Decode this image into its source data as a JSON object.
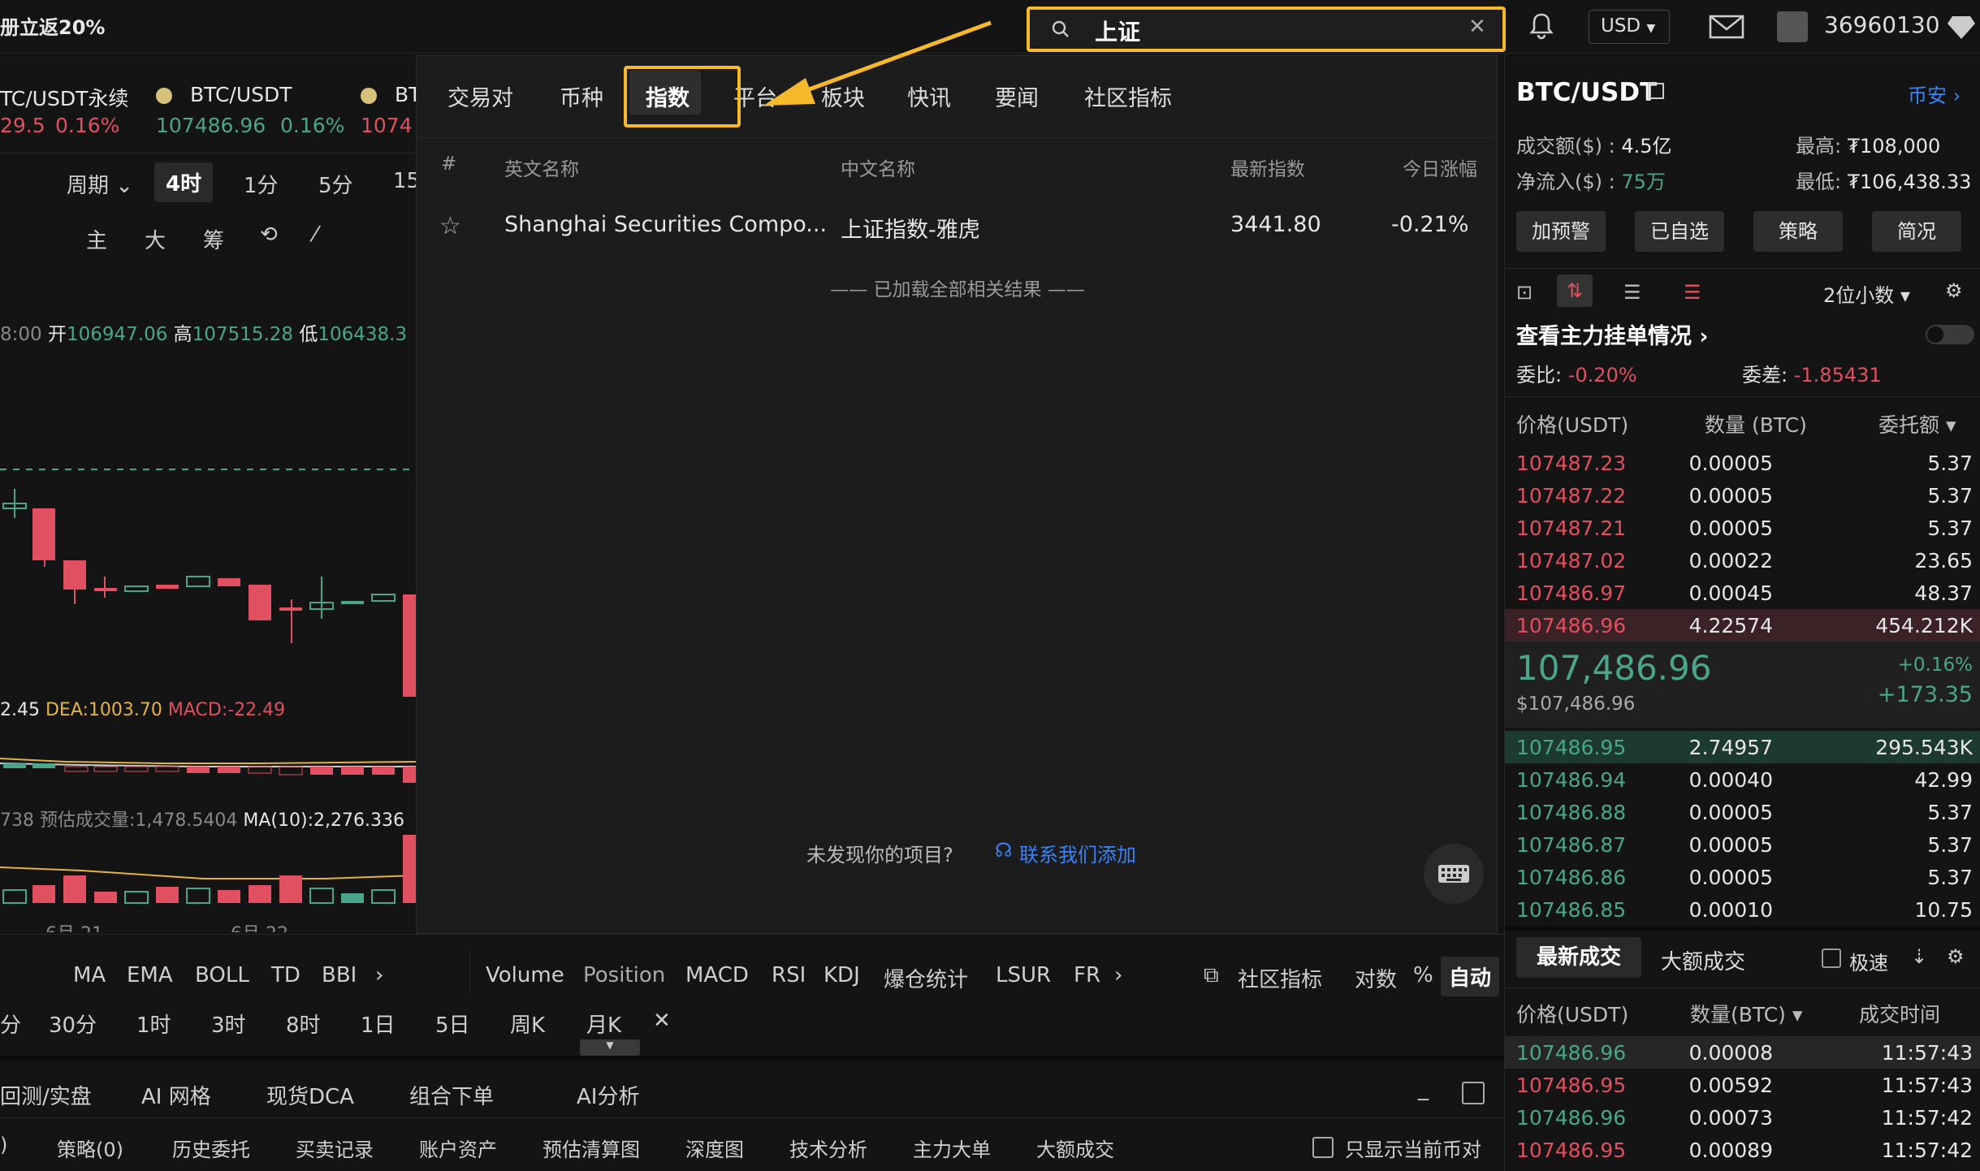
{
  "topbar": {
    "promo": "册立返20%",
    "search_value": "上证",
    "currency": "USD",
    "user_id": "36960130"
  },
  "chart": {
    "tickers": [
      {
        "name": "TC/USDT永续",
        "price": "29.5",
        "change": "0.16%"
      },
      {
        "name": "BTC/USDT",
        "price": "107486.96",
        "change": "0.16%"
      },
      {
        "name": "BT",
        "price": "1074"
      }
    ],
    "period_label": "周期",
    "periods": [
      "4时",
      "1分",
      "5分",
      "15"
    ],
    "indicators_icons": [
      "主",
      "大",
      "筹"
    ],
    "ohlc": {
      "time": "8:00",
      "open_label": "开",
      "open": "106947.06",
      "high_label": "高",
      "high": "107515.28",
      "low_label": "低",
      "low": "106438.3"
    },
    "macd": {
      "dif": "2.45",
      "dea": "DEA:1003.70",
      "macd": "MACD:-22.49"
    },
    "volume": {
      "v": "738",
      "est": "预估成交量:1,478.5404",
      "ma": "MA(10):2,276.336"
    },
    "dates": [
      "6月 21",
      "6月 22"
    ],
    "indicator_bar": [
      "MA",
      "EMA",
      "BOLL",
      "TD",
      "BBI"
    ],
    "sub_indicators": [
      "Volume",
      "Position",
      "MACD",
      "RSI",
      "KDJ",
      "爆仓统计",
      "LSUR",
      "FR"
    ],
    "community": "社区指标",
    "log": "对数",
    "percent": "%",
    "auto": "自动",
    "intervals": [
      "分",
      "30分",
      "1时",
      "3时",
      "8时",
      "1日",
      "5日",
      "周K",
      "月K"
    ],
    "bottom_tabs": [
      "回测/实盘",
      "AI 网格",
      "现货DCA",
      "组合下单",
      "AI分析"
    ],
    "order_tabs": [
      ")",
      "策略(0)",
      "历史委托",
      "买卖记录",
      "账户资产",
      "预估清算图",
      "深度图",
      "技术分析",
      "主力大单",
      "大额成交"
    ],
    "only_current": "只显示当前币对"
  },
  "dropdown": {
    "tabs": [
      "交易对",
      "币种",
      "指数",
      "平台",
      "板块",
      "快讯",
      "要闻",
      "社区指标"
    ],
    "selected_tab": "指数",
    "headers": [
      "#",
      "英文名称",
      "中文名称",
      "最新指数",
      "今日涨幅"
    ],
    "rows": [
      {
        "en": "Shanghai Securities Compo...",
        "cn": "上证指数-雅虎",
        "value": "3441.80",
        "change": "-0.21%"
      }
    ],
    "loaded_all": "—— 已加载全部相关结果 ——",
    "not_found": "未发现你的项目?",
    "contact": "联系我们添加"
  },
  "right": {
    "pair": "BTC/USDT",
    "exchange": "币安",
    "volume_label": "成交额($) :",
    "volume": "4.5亿",
    "netflow_label": "净流入($) :",
    "netflow": "75万",
    "high_label": "最高:",
    "high": "₮108,000",
    "low_label": "最低:",
    "low": "₮106,438.33",
    "buttons": [
      "加预警",
      "已自选",
      "策略",
      "简况"
    ],
    "decimals": "2位小数",
    "main_orders": "查看主力挂单情况",
    "ratio_label": "委比:",
    "ratio": "-0.20%",
    "diff_label": "委差:",
    "diff": "-1.85431",
    "ob_headers": [
      "价格(USDT)",
      "数量 (BTC)",
      "委托额"
    ],
    "asks": [
      [
        "107487.23",
        "0.00005",
        "5.37"
      ],
      [
        "107487.22",
        "0.00005",
        "5.37"
      ],
      [
        "107487.21",
        "0.00005",
        "5.37"
      ],
      [
        "107487.02",
        "0.00022",
        "23.65"
      ],
      [
        "107486.97",
        "0.00045",
        "48.37"
      ],
      [
        "107486.96",
        "4.22574",
        "454.212K"
      ]
    ],
    "last_price": "107,486.96",
    "last_usd": "$107,486.96",
    "change_pct": "+0.16%",
    "change_abs": "+173.35",
    "bids": [
      [
        "107486.95",
        "2.74957",
        "295.543K"
      ],
      [
        "107486.94",
        "0.00040",
        "42.99"
      ],
      [
        "107486.88",
        "0.00005",
        "5.37"
      ],
      [
        "107486.87",
        "0.00005",
        "5.37"
      ],
      [
        "107486.86",
        "0.00005",
        "5.37"
      ],
      [
        "107486.85",
        "0.00010",
        "10.75"
      ]
    ],
    "trade_tabs": [
      "最新成交",
      "大额成交"
    ],
    "fast": "极速",
    "trade_headers": [
      "价格(USDT)",
      "数量(BTC)",
      "成交时间"
    ],
    "trades": [
      [
        "107486.96",
        "0.00008",
        "11:57:43",
        "buy"
      ],
      [
        "107486.95",
        "0.00592",
        "11:57:43",
        "sell"
      ],
      [
        "107486.96",
        "0.00073",
        "11:57:42",
        "buy"
      ],
      [
        "107486.95",
        "0.00089",
        "11:57:42",
        "sell"
      ]
    ]
  },
  "colors": {
    "accent": "#f5b92b",
    "up": "#4ba58a",
    "down": "#e05060",
    "link": "#3b82f6"
  }
}
